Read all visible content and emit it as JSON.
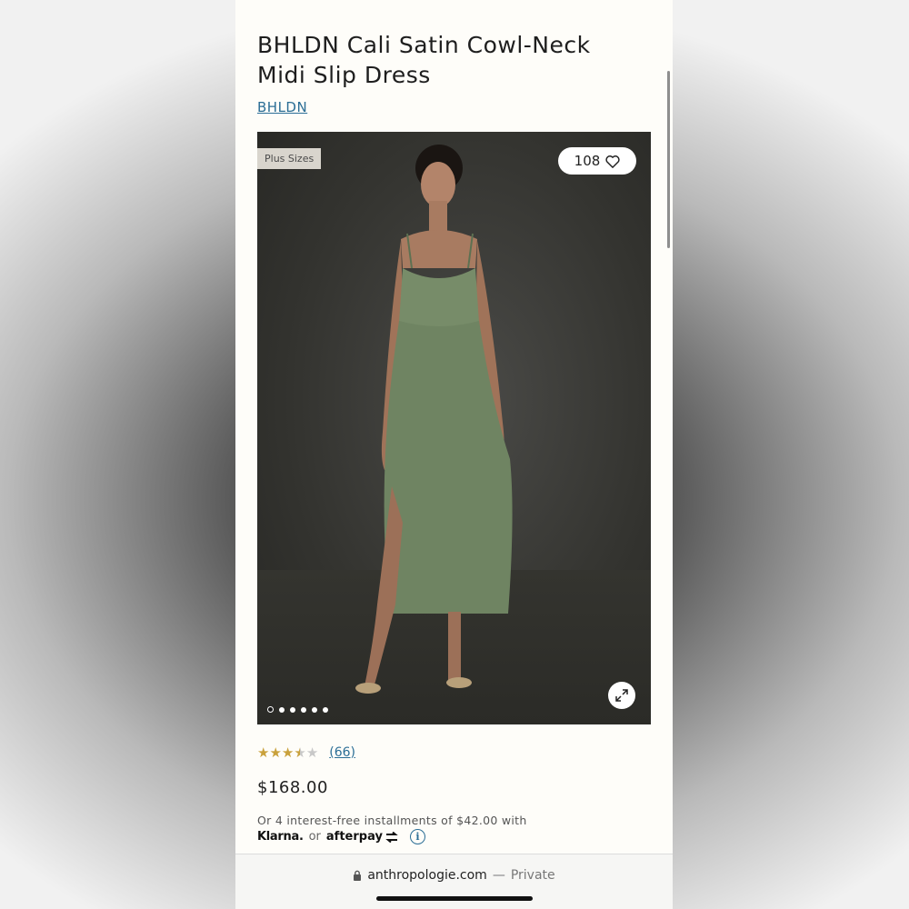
{
  "product": {
    "title": "BHLDN Cali Satin Cowl-Neck Midi Slip Dress",
    "brand": "BHLDN",
    "badge": "Plus Sizes",
    "favorites_count": "108",
    "image_dots": {
      "total": 6,
      "active_index": 0
    },
    "rating": {
      "stars": 3.5,
      "max": 5,
      "count_text": "(66)"
    },
    "price": "$168.00",
    "installments_text": "Or 4 interest-free installments of $42.00 with",
    "pay_providers": {
      "klarna": "Klarna.",
      "or": "or",
      "afterpay": "afterpay"
    }
  },
  "browser": {
    "domain": "anthropologie.com",
    "separator": "—",
    "mode": "Private"
  },
  "colors": {
    "dress": "#6f8462",
    "link": "#2b6e96",
    "star": "#c9a13c",
    "background": "#fefdf9"
  }
}
